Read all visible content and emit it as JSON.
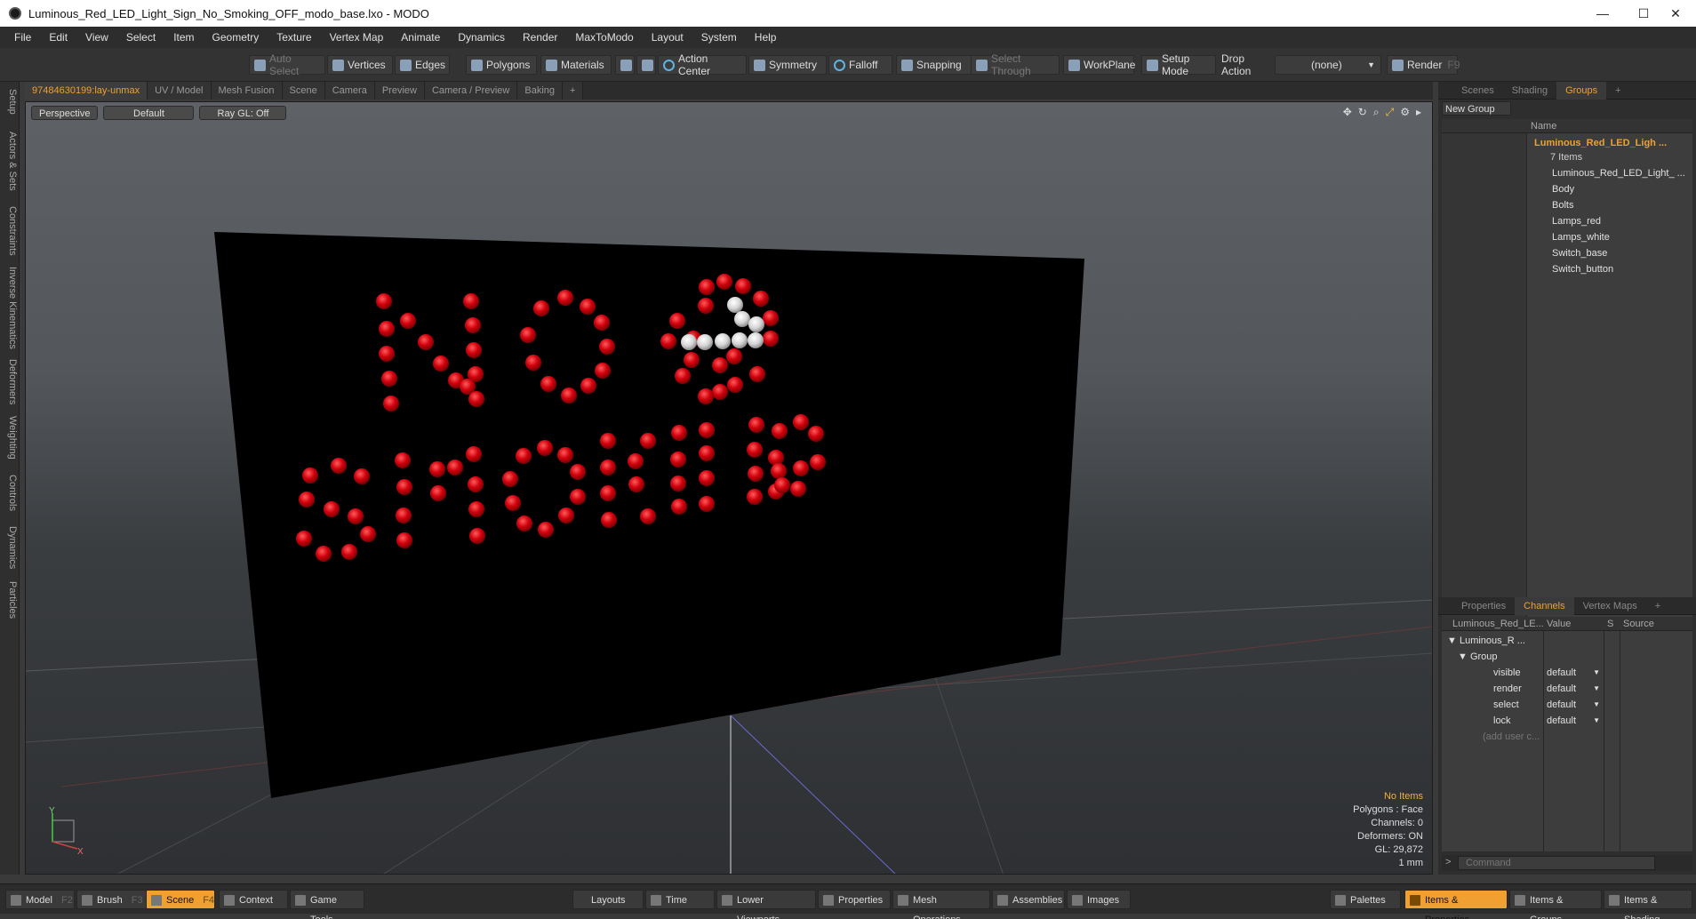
{
  "window": {
    "title": "Luminous_Red_LED_Light_Sign_No_Smoking_OFF_modo_base.lxo - MODO",
    "minimize": "—",
    "maximize": "☐",
    "close": "✕"
  },
  "menu": [
    "File",
    "Edit",
    "View",
    "Select",
    "Item",
    "Geometry",
    "Texture",
    "Vertex Map",
    "Animate",
    "Dynamics",
    "Render",
    "MaxToModo",
    "Layout",
    "System",
    "Help"
  ],
  "toolbar": {
    "auto_select": "Auto Select",
    "vertices": "Vertices",
    "edges": "Edges",
    "polygons": "Polygons",
    "materials": "Materials",
    "action_center": "Action Center",
    "symmetry": "Symmetry",
    "falloff": "Falloff",
    "snapping": "Snapping",
    "select_through": "Select Through",
    "workplane": "WorkPlane",
    "setup_mode": "Setup Mode",
    "drop_action": "Drop Action",
    "drop_value": "(none)",
    "render": "Render",
    "render_key": "F9"
  },
  "left_tabs": [
    "Setup",
    "Actors & Sets",
    "Constraints",
    "Inverse Kinematics",
    "Deformers",
    "Weighting",
    "Controls",
    "Dynamics",
    "Particles"
  ],
  "viewport_tabs": [
    "97484630199:lay-unmax",
    "UV / Model",
    "Mesh Fusion",
    "Scene",
    "Camera",
    "Preview",
    "Camera / Preview",
    "Baking",
    "+"
  ],
  "viewport": {
    "view": "Perspective",
    "shading": "Default",
    "raygl": "Ray GL: Off",
    "stats": {
      "sel": "No Items",
      "polygons": "Polygons : Face",
      "channels": "Channels: 0",
      "deformers": "Deformers: ON",
      "gl": "GL: 29,872",
      "unit": "1 mm"
    },
    "axis_labels": {
      "y": "Y",
      "x": "X"
    }
  },
  "scene_panel": {
    "tabs": [
      "Scenes",
      "Shading",
      "Groups",
      "+"
    ],
    "new_group": "New Group",
    "name_header": "Name",
    "group": {
      "name": "Luminous_Red_LED_Ligh ...",
      "count": "7 Items"
    },
    "items": [
      "Luminous_Red_LED_Light_ ...",
      "Body",
      "Bolts",
      "Lamps_red",
      "Lamps_white",
      "Switch_base",
      "Switch_button"
    ]
  },
  "properties_panel": {
    "tabs": [
      "Properties",
      "Channels",
      "Vertex Maps",
      "+"
    ],
    "headers": {
      "name": "Luminous_Red_LE...",
      "value": "Value",
      "s": "S",
      "source": "Source"
    },
    "root": "Luminous_R ...",
    "group": "Group",
    "channels": [
      {
        "name": "visible",
        "value": "default"
      },
      {
        "name": "render",
        "value": "default"
      },
      {
        "name": "select",
        "value": "default"
      },
      {
        "name": "lock",
        "value": "default"
      }
    ],
    "add_user": "(add user c...",
    "command_placeholder": "Command",
    "prompt": ">"
  },
  "bottom": {
    "model": "Model",
    "model_key": "F2",
    "brush": "Brush",
    "brush_key": "F3",
    "scene": "Scene",
    "scene_key": "F4",
    "context": "Context",
    "game_tools": "Game Tools",
    "layouts": "Layouts",
    "time": "Time",
    "lower_viewports": "Lower Viewports",
    "properties": "Properties",
    "mesh_operations": "Mesh Operations",
    "assemblies": "Assemblies",
    "images": "Images",
    "palettes": "Palettes",
    "items_properties": "Items & Properties",
    "items_groups": "Items & Groups",
    "items_shading": "Items & Shading"
  },
  "colors": {
    "accent": "#f0a030",
    "led_red": "#c4000a",
    "led_white": "#d8d8d8",
    "sign": "#000000"
  }
}
